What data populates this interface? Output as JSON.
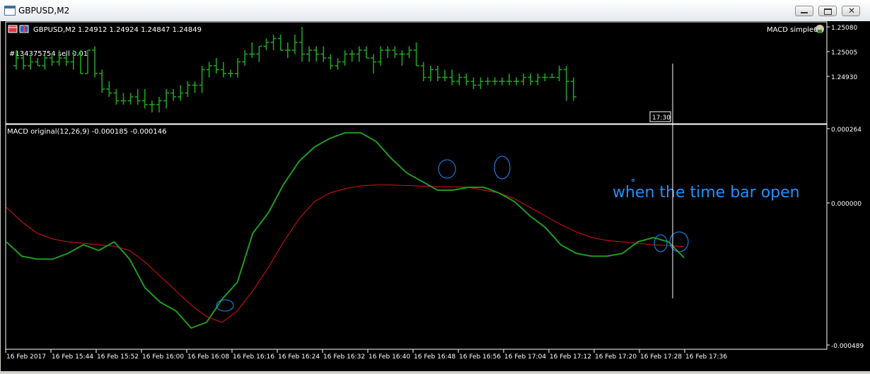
{
  "window": {
    "title": "GBPUSD,M2",
    "controls": {
      "minimize": "minimize",
      "maximize": "maximize",
      "close": "✕"
    }
  },
  "colors": {
    "background": "#000000",
    "frame": "#ffffff",
    "price_bars": "#1fa11f",
    "macd_main": "#1f9a1f",
    "macd_signal": "#e01010",
    "crosshair": "#ffffff",
    "annotation": "#1e90ff",
    "circle": "#1e90ff"
  },
  "price_panel": {
    "symbol_label": "GBPUSD,M2",
    "ohlc_label": "1.24912 1.24924 1.24847 1.24849",
    "order_label": "#134375754 sell 0.01",
    "indicator_name": "MACD simple6",
    "y_ticks": [
      "1.25080",
      "1.25005",
      "1.24930"
    ],
    "crosshair_time_label": "17:30"
  },
  "macd_panel": {
    "label": "MACD original(12,26,9) -0.000185 -0.000146",
    "y_ticks": [
      "0.000264",
      "0.000000",
      "-0.000489"
    ],
    "annotation_text": "when the time bar open"
  },
  "x_axis": {
    "labels": [
      "16 Feb 2017",
      "16 Feb 15:44",
      "16 Feb 15:52",
      "16 Feb 16:00",
      "16 Feb 16:08",
      "16 Feb 16:16",
      "16 Feb 16:24",
      "16 Feb 16:32",
      "16 Feb 16:40",
      "16 Feb 16:48",
      "16 Feb 16:56",
      "16 Feb 17:04",
      "16 Feb 17:12",
      "16 Feb 17:20",
      "16 Feb 17:28",
      "16 Feb 17:36"
    ]
  },
  "chart_data": [
    {
      "type": "bar",
      "title": "GBPUSD,M2",
      "ylim": [
        1.2486,
        1.251
      ],
      "bars": [
        [
          1.25,
          1.2504,
          1.2499,
          1.2502
        ],
        [
          1.2502,
          1.2503,
          1.2499,
          1.25
        ],
        [
          1.25,
          1.2503,
          1.2499,
          1.2501
        ],
        [
          1.2501,
          1.2502,
          1.25,
          1.25
        ],
        [
          1.25,
          1.2503,
          1.2499,
          1.2502
        ],
        [
          1.2502,
          1.2503,
          1.25,
          1.2501
        ],
        [
          1.2501,
          1.2504,
          1.25,
          1.2502
        ],
        [
          1.2502,
          1.2503,
          1.25,
          1.2501
        ],
        [
          1.2501,
          1.2504,
          1.2499,
          1.2503
        ],
        [
          1.2503,
          1.2504,
          1.2498,
          1.2498
        ],
        [
          1.2498,
          1.2504,
          1.2498,
          1.2504
        ],
        [
          1.2504,
          1.2505,
          1.2497,
          1.2498
        ],
        [
          1.2498,
          1.2499,
          1.2493,
          1.2494
        ],
        [
          1.2494,
          1.2496,
          1.2492,
          1.2493
        ],
        [
          1.2493,
          1.2494,
          1.249,
          1.2491
        ],
        [
          1.2491,
          1.2493,
          1.249,
          1.2491
        ],
        [
          1.2491,
          1.2493,
          1.249,
          1.2492
        ],
        [
          1.2492,
          1.2494,
          1.249,
          1.2491
        ],
        [
          1.2491,
          1.2494,
          1.2489,
          1.249
        ],
        [
          1.249,
          1.2491,
          1.2488,
          1.249
        ],
        [
          1.249,
          1.2492,
          1.2488,
          1.2491
        ],
        [
          1.2491,
          1.2494,
          1.2489,
          1.2493
        ],
        [
          1.2493,
          1.2494,
          1.2491,
          1.2492
        ],
        [
          1.2492,
          1.2495,
          1.2491,
          1.2493
        ],
        [
          1.2493,
          1.2496,
          1.2492,
          1.2495
        ],
        [
          1.2495,
          1.2496,
          1.2493,
          1.2495
        ],
        [
          1.2495,
          1.25,
          1.2493,
          1.2499
        ],
        [
          1.2499,
          1.2501,
          1.2497,
          1.25
        ],
        [
          1.25,
          1.2502,
          1.2498,
          1.2499
        ],
        [
          1.2499,
          1.2501,
          1.2497,
          1.2498
        ],
        [
          1.2498,
          1.2499,
          1.2497,
          1.2498
        ],
        [
          1.2498,
          1.2502,
          1.2497,
          1.2501
        ],
        [
          1.2501,
          1.2504,
          1.25,
          1.2503
        ],
        [
          1.2503,
          1.2506,
          1.2502,
          1.2503
        ],
        [
          1.2503,
          1.2505,
          1.2501,
          1.2505
        ],
        [
          1.2505,
          1.2507,
          1.2504,
          1.2506
        ],
        [
          1.2506,
          1.2508,
          1.2504,
          1.2507
        ],
        [
          1.2507,
          1.2508,
          1.2504,
          1.2504
        ],
        [
          1.2504,
          1.2506,
          1.2502,
          1.2504
        ],
        [
          1.2504,
          1.2508,
          1.2503,
          1.2506
        ],
        [
          1.2506,
          1.251,
          1.2501,
          1.2503
        ],
        [
          1.2503,
          1.2505,
          1.2501,
          1.2504
        ],
        [
          1.2504,
          1.2505,
          1.2501,
          1.2503
        ],
        [
          1.2503,
          1.2505,
          1.2501,
          1.2502
        ],
        [
          1.2502,
          1.2503,
          1.2499,
          1.25
        ],
        [
          1.25,
          1.2502,
          1.2499,
          1.2501
        ],
        [
          1.2501,
          1.2504,
          1.25,
          1.2503
        ],
        [
          1.2503,
          1.2504,
          1.2501,
          1.2503
        ],
        [
          1.2503,
          1.2505,
          1.2501,
          1.2504
        ],
        [
          1.2504,
          1.2505,
          1.2502,
          1.2502
        ],
        [
          1.2502,
          1.2503,
          1.2498,
          1.2501
        ],
        [
          1.2501,
          1.2505,
          1.25,
          1.2504
        ],
        [
          1.2504,
          1.2505,
          1.2502,
          1.2504
        ],
        [
          1.2504,
          1.2505,
          1.2502,
          1.2503
        ],
        [
          1.2503,
          1.2504,
          1.25,
          1.2503
        ],
        [
          1.2503,
          1.2505,
          1.2502,
          1.2504
        ],
        [
          1.2504,
          1.2506,
          1.25,
          1.25
        ],
        [
          1.25,
          1.2501,
          1.2496,
          1.2497
        ],
        [
          1.2497,
          1.25,
          1.2496,
          1.2499
        ],
        [
          1.2499,
          1.25,
          1.2496,
          1.2497
        ],
        [
          1.2497,
          1.2499,
          1.2496,
          1.2497
        ],
        [
          1.2497,
          1.2499,
          1.2495,
          1.2496
        ],
        [
          1.2496,
          1.2498,
          1.2495,
          1.2497
        ],
        [
          1.2497,
          1.2498,
          1.2495,
          1.2496
        ],
        [
          1.2496,
          1.2497,
          1.2494,
          1.2495
        ],
        [
          1.2495,
          1.2497,
          1.2494,
          1.2496
        ],
        [
          1.2496,
          1.2497,
          1.2495,
          1.2496
        ],
        [
          1.2496,
          1.2497,
          1.2495,
          1.2496
        ],
        [
          1.2496,
          1.2497,
          1.2495,
          1.2496
        ],
        [
          1.2496,
          1.2498,
          1.2495,
          1.2496
        ],
        [
          1.2496,
          1.2497,
          1.2495,
          1.2496
        ],
        [
          1.2496,
          1.2498,
          1.2495,
          1.2497
        ],
        [
          1.2497,
          1.2498,
          1.2495,
          1.2496
        ],
        [
          1.2496,
          1.2498,
          1.2495,
          1.2497
        ],
        [
          1.2497,
          1.2498,
          1.2496,
          1.2497
        ],
        [
          1.2497,
          1.2498,
          1.2497,
          1.2497
        ],
        [
          1.2497,
          1.25,
          1.2496,
          1.2499
        ],
        [
          1.2499,
          1.25,
          1.2491,
          1.2496
        ],
        [
          1.2496,
          1.2497,
          1.2491,
          1.2492
        ]
      ]
    },
    {
      "type": "line",
      "title": "MACD original(12,26,9) -0.000185 -0.000146",
      "ylim": [
        -0.000489,
        0.000264
      ],
      "series": [
        {
          "name": "MACD",
          "values": [
            -0.00013,
            -0.00018,
            -0.00019,
            -0.00019,
            -0.00017,
            -0.00014,
            -0.00016,
            -0.00013,
            -0.00019,
            -0.00029,
            -0.00034,
            -0.00037,
            -0.00043,
            -0.00041,
            -0.00033,
            -0.00027,
            -0.0001,
            -3e-05,
            7e-05,
            0.00015,
            0.0002,
            0.00023,
            0.00025,
            0.00025,
            0.00022,
            0.00016,
            0.00011,
            8e-05,
            5e-05,
            5e-05,
            6e-05,
            6e-05,
            4e-05,
            1e-05,
            -4e-05,
            -8e-05,
            -0.00014,
            -0.00017,
            -0.00018,
            -0.00018,
            -0.00017,
            -0.00013,
            -0.000115,
            -0.00013,
            -0.000185
          ]
        },
        {
          "name": "Signal",
          "values": [
            -1e-05,
            -6e-05,
            -0.0001,
            -0.00012,
            -0.00013,
            -0.000135,
            -0.00014,
            -0.000145,
            -0.00016,
            -0.0002,
            -0.00025,
            -0.0003,
            -0.00035,
            -0.00039,
            -0.00041,
            -0.00037,
            -0.0003,
            -0.00022,
            -0.00013,
            -5e-05,
            1e-05,
            4e-05,
            5.5e-05,
            6.5e-05,
            6.8e-05,
            6.8e-05,
            6.6e-05,
            6.4e-05,
            6.2e-05,
            6.2e-05,
            6e-05,
            5e-05,
            4e-05,
            2e-05,
            -1e-05,
            -4e-05,
            -7e-05,
            -9.5e-05,
            -0.000115,
            -0.000125,
            -0.00013,
            -0.000135,
            -0.00014,
            -0.000143,
            -0.000146
          ]
        }
      ]
    }
  ]
}
